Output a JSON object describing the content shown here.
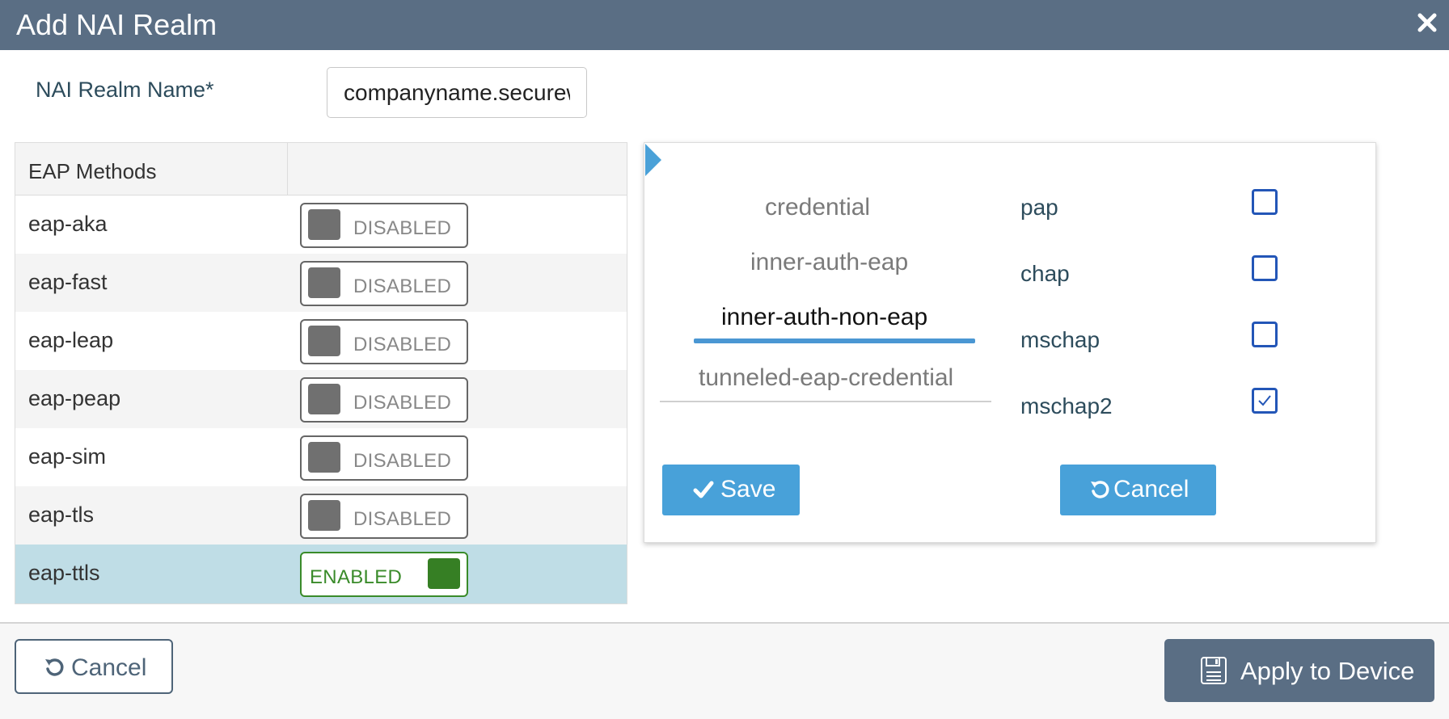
{
  "dialog": {
    "title": "Add NAI Realm",
    "close_icon": "close-icon"
  },
  "realm": {
    "label": "NAI Realm Name*",
    "value": "companyname.securewifi.com"
  },
  "eap_table": {
    "header": "EAP Methods",
    "rows": [
      {
        "name": "eap-aka",
        "state": "DISABLED"
      },
      {
        "name": "eap-fast",
        "state": "DISABLED"
      },
      {
        "name": "eap-leap",
        "state": "DISABLED"
      },
      {
        "name": "eap-peap",
        "state": "DISABLED"
      },
      {
        "name": "eap-sim",
        "state": "DISABLED"
      },
      {
        "name": "eap-tls",
        "state": "DISABLED"
      },
      {
        "name": "eap-ttls",
        "state": "ENABLED"
      }
    ]
  },
  "panel": {
    "tabs": [
      {
        "label": "credential",
        "active": false
      },
      {
        "label": "inner-auth-eap",
        "active": false
      },
      {
        "label": "inner-auth-non-eap",
        "active": true
      },
      {
        "label": "tunneled-eap-credential",
        "active": false
      }
    ],
    "options": [
      {
        "label": "pap",
        "checked": false
      },
      {
        "label": "chap",
        "checked": false
      },
      {
        "label": "mschap",
        "checked": false
      },
      {
        "label": "mschap2",
        "checked": true
      }
    ],
    "save_label": "Save",
    "cancel_label": "Cancel"
  },
  "footer": {
    "cancel_label": "Cancel",
    "apply_label": "Apply to Device"
  },
  "colors": {
    "header": "#5a6e84",
    "accent_blue": "#48a1d9",
    "enabled_green": "#367f24",
    "selected_row": "#bfdde6",
    "checkbox": "#2356b7"
  }
}
